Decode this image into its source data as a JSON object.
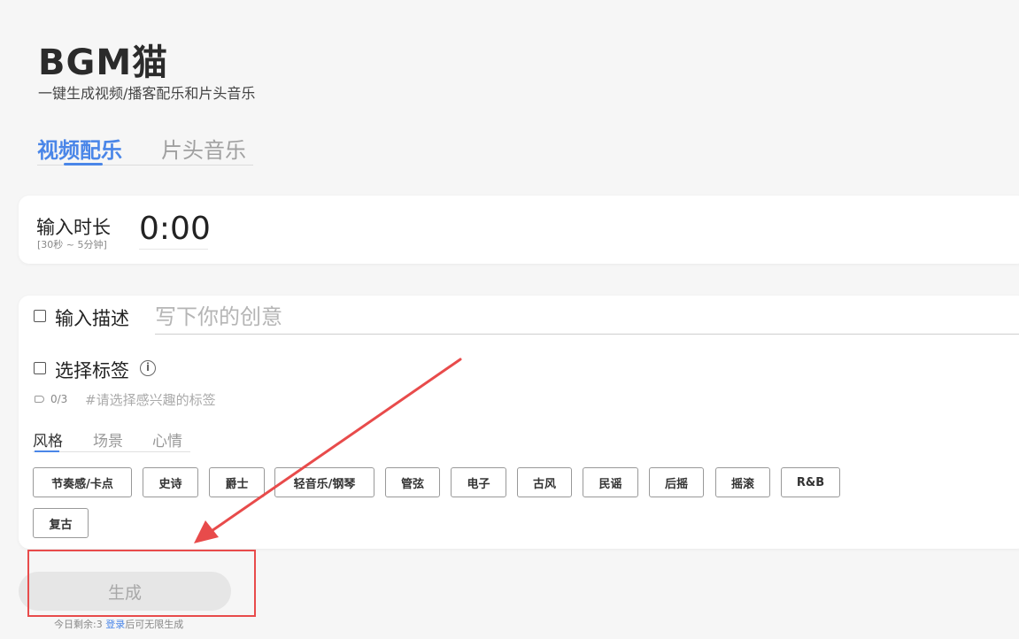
{
  "header": {
    "logo": "BGM猫",
    "subtitle": "一键生成视频/播客配乐和片头音乐"
  },
  "tabs": [
    {
      "label": "视频配乐",
      "active": true
    },
    {
      "label": "片头音乐",
      "active": false
    }
  ],
  "duration": {
    "label": "输入时长",
    "hint": "[30秒 ~ 5分钟]",
    "value": "0:00"
  },
  "description": {
    "label": "输入描述",
    "placeholder": "写下你的创意",
    "checked": false
  },
  "tags": {
    "label": "选择标签",
    "checked": false,
    "count": "0/3",
    "hint": "#请选择感兴趣的标签",
    "categories": [
      "风格",
      "场景",
      "心情"
    ],
    "active_category": "风格",
    "items": [
      "节奏感/卡点",
      "史诗",
      "爵士",
      "轻音乐/钢琴",
      "管弦",
      "电子",
      "古风",
      "民谣",
      "后摇",
      "摇滚",
      "R&B",
      "复古"
    ]
  },
  "generate": {
    "label": "生成",
    "quota_prefix": "今日剩余:3 ",
    "login_link": "登录",
    "quota_suffix": "后可无限生成"
  },
  "annotation": {
    "color": "#e84b4b"
  }
}
